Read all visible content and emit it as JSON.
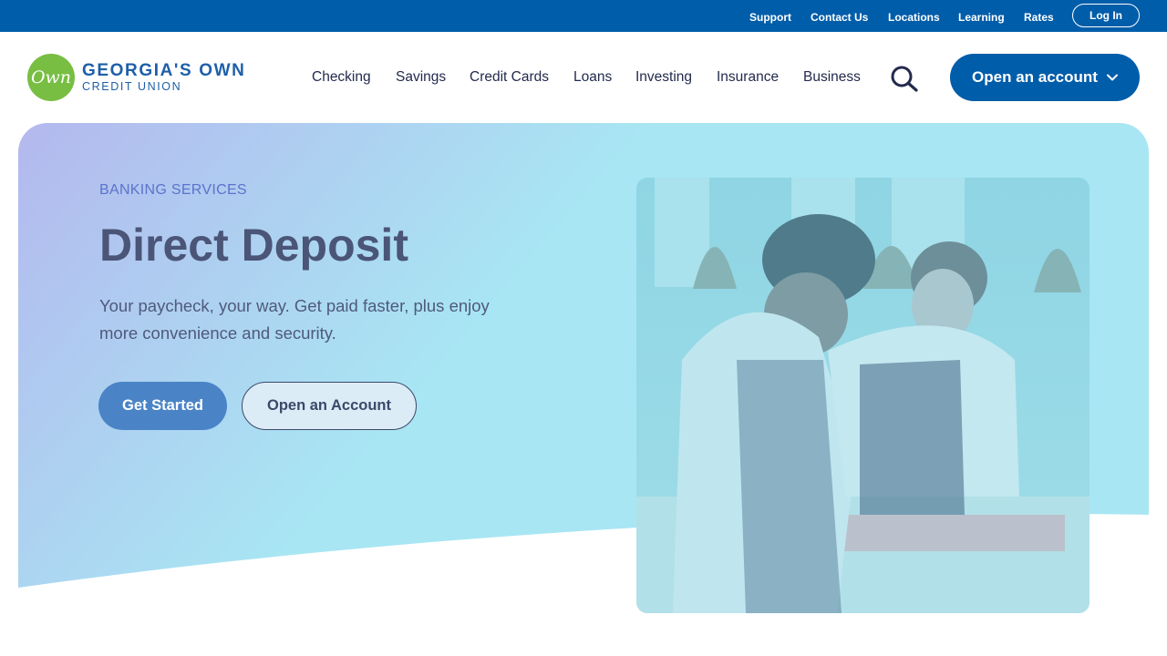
{
  "utility_nav": {
    "links": [
      "Support",
      "Contact Us",
      "Locations",
      "Learning",
      "Rates"
    ],
    "login_label": "Log In"
  },
  "brand": {
    "logo_mark": "Own",
    "name": "GEORGIA'S OWN",
    "subname": "CREDIT UNION"
  },
  "main_nav": {
    "items": [
      "Checking",
      "Savings",
      "Credit Cards",
      "Loans",
      "Investing",
      "Insurance",
      "Business"
    ],
    "open_account_label": "Open an account"
  },
  "hero": {
    "eyebrow": "BANKING SERVICES",
    "title": "Direct Deposit",
    "description": "Your paycheck, your way. Get paid faster, plus enjoy more convenience and security.",
    "primary_cta": "Get Started",
    "secondary_cta": "Open an Account"
  },
  "colors": {
    "brand_blue": "#005daa",
    "brand_green": "#78be43",
    "hero_gradient_start": "#b4b8ee",
    "hero_gradient_end": "#a8e6f3"
  },
  "icons": {
    "search": "search-icon",
    "dropdown": "chevron-down-icon"
  }
}
